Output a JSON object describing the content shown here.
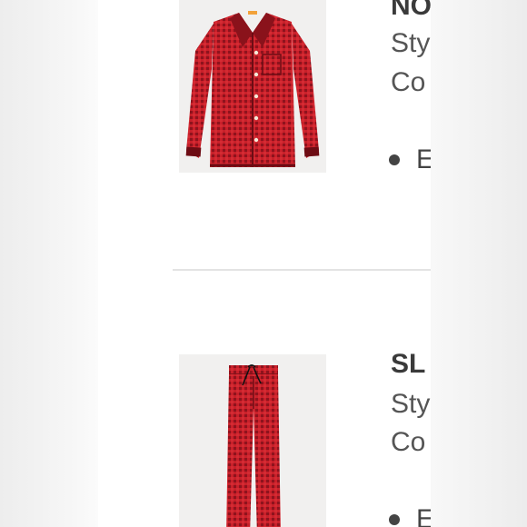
{
  "products": [
    {
      "image_label": "pajama-top",
      "name": "NO",
      "style_line": "Sty",
      "color_line": "Co",
      "bullet_text": "E"
    },
    {
      "image_label": "pajama-pants",
      "name": "SL",
      "style_line": "Sty",
      "color_line": "Co",
      "bullet_text": "E"
    }
  ],
  "colors": {
    "fabric_red": "#c8202a",
    "check_dark": "#7a0f18",
    "panel_bg": "#ffffff",
    "image_bg": "#f1f0ef"
  }
}
